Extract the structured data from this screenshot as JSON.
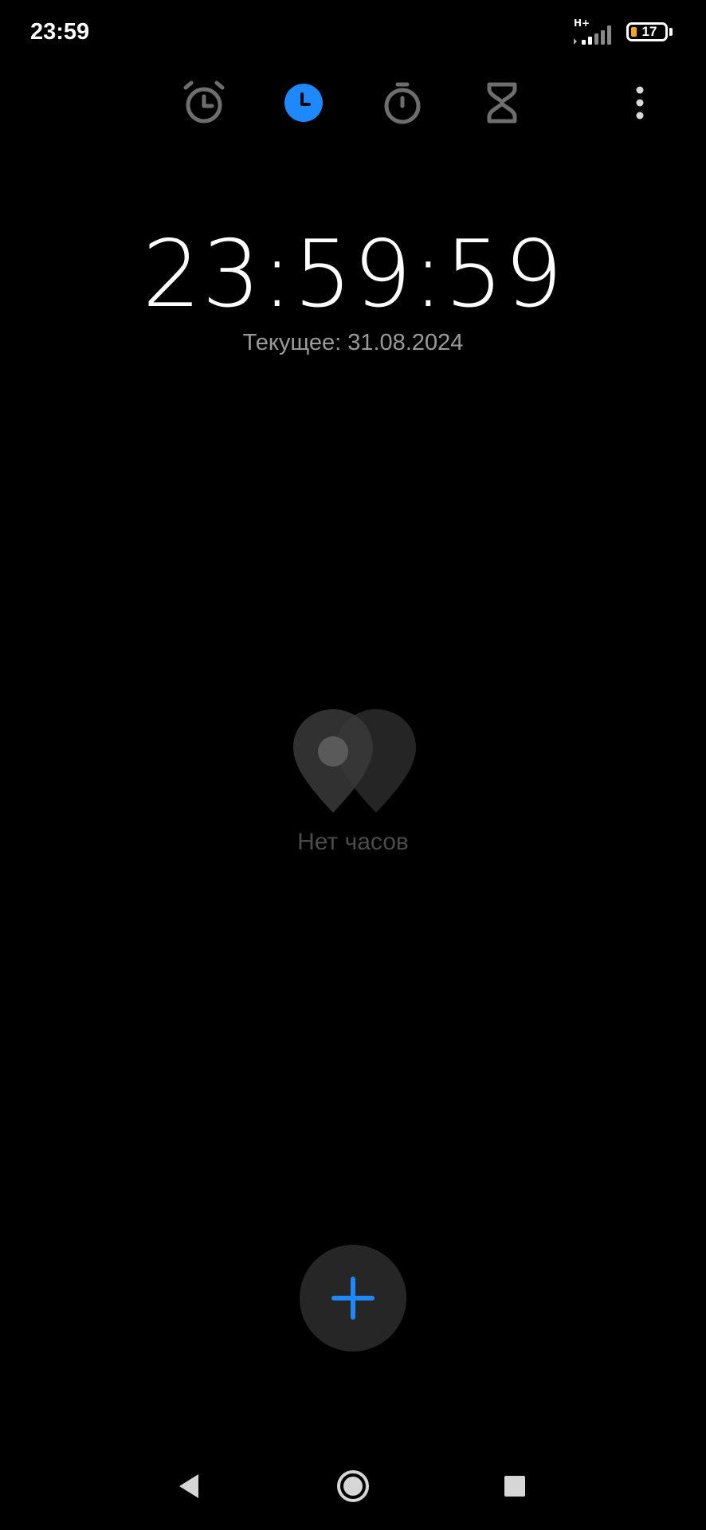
{
  "status_bar": {
    "time": "23:59",
    "network_type": "H+",
    "battery_level": "17",
    "battery_fraction": 0.17,
    "battery_color": "#f5a623",
    "icons": [
      "signal-icon",
      "battery-icon"
    ]
  },
  "tabs": [
    {
      "name": "alarm",
      "icon": "alarm-clock-icon",
      "active": false
    },
    {
      "name": "clock",
      "icon": "clock-icon",
      "active": true
    },
    {
      "name": "stopwatch",
      "icon": "stopwatch-icon",
      "active": false
    },
    {
      "name": "timer",
      "icon": "hourglass-icon",
      "active": false
    }
  ],
  "accent_color": "#1e88ff",
  "clock": {
    "time": "23:59:59",
    "date_label": "Текущее: 31.08.2024"
  },
  "empty_state": {
    "icon": "world-clock-pins-icon",
    "text": "Нет часов"
  },
  "fab": {
    "icon": "plus-icon"
  },
  "nav": {
    "back": "back-icon",
    "home": "home-icon",
    "recents": "recents-icon"
  }
}
